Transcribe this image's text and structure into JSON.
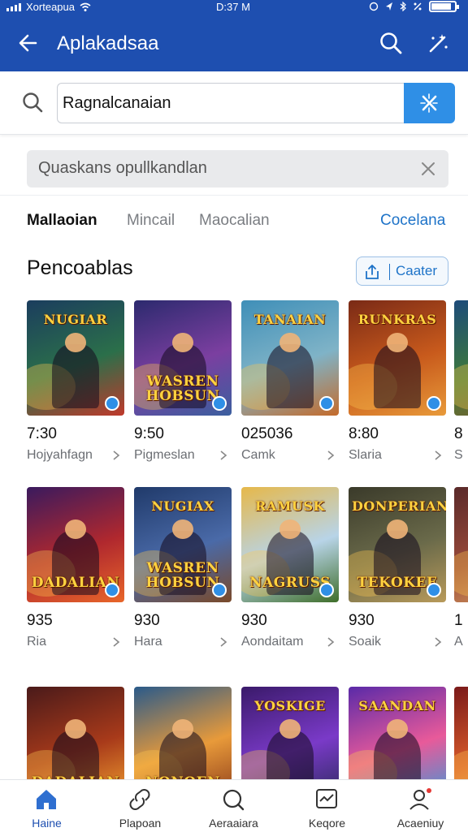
{
  "status_bar": {
    "carrier": "Xorteapua",
    "time": "D:37 M"
  },
  "app_bar": {
    "title": "Aplakadsaa"
  },
  "search": {
    "value": "Ragnalcanaian"
  },
  "query_chip": {
    "text": "Quaskans opullkandlan"
  },
  "tabs": [
    {
      "label": "Mallaoian"
    },
    {
      "label": "Mincail"
    },
    {
      "label": "Maocalian"
    },
    {
      "label": "Cocelana"
    }
  ],
  "section": {
    "title": "Pencoablas",
    "filter_label": "Caater"
  },
  "cards": [
    {
      "art_top": "NUGIAR",
      "art_bottom": "",
      "price": "7:30",
      "sub": "Hojyahfagn",
      "palette": [
        "#1b3d5e",
        "#2b6f4a",
        "#c0392b"
      ]
    },
    {
      "art_top": "",
      "art_bottom": "WASREN HOBSUN",
      "price": "9:50",
      "sub": "Pigmeslan",
      "palette": [
        "#2c2a6e",
        "#7b3fa0",
        "#3b5f9f"
      ]
    },
    {
      "art_top": "TANAIAN",
      "art_bottom": "",
      "price": "025036",
      "sub": "Camk",
      "palette": [
        "#3f8fb8",
        "#7fb3c7",
        "#c46b2b"
      ]
    },
    {
      "art_top": "RUNKRAS",
      "art_bottom": "",
      "price": "8:80",
      "sub": "Slaria",
      "palette": [
        "#7a2a16",
        "#c85a1c",
        "#e89a3a"
      ]
    },
    {
      "art_top": "",
      "art_bottom": "",
      "price": "8",
      "sub": "S",
      "palette": [
        "#1d4b7a",
        "#3e7a3a",
        "#8a5a2a"
      ]
    },
    {
      "art_top": "",
      "art_bottom": "DADALIAN",
      "price": "935",
      "sub": "Ria",
      "palette": [
        "#3a1a5e",
        "#b0282e",
        "#e8662a"
      ]
    },
    {
      "art_top": "NUGIAX",
      "art_bottom": "WASREN HOBSUN",
      "price": "930",
      "sub": "Hara",
      "palette": [
        "#203a6a",
        "#4a6aa8",
        "#7a4a2a"
      ]
    },
    {
      "art_top": "RAMUSK",
      "art_bottom": "NAGRUSS",
      "price": "930",
      "sub": "Aondaitam",
      "palette": [
        "#e6b84a",
        "#b8d4e8",
        "#3f6e2a"
      ]
    },
    {
      "art_top": "DONPERIAN",
      "art_bottom": "TEKOKEE",
      "price": "930",
      "sub": "Soaik",
      "palette": [
        "#3a3a2a",
        "#6a6a4a",
        "#b89a5a"
      ]
    },
    {
      "art_top": "",
      "art_bottom": "",
      "price": "1",
      "sub": "A",
      "palette": [
        "#5a2a2a",
        "#9a4a3a",
        "#d8a060"
      ]
    },
    {
      "art_top": "",
      "art_bottom": "DADALIAN",
      "price": "",
      "sub": "",
      "palette": [
        "#4a1a1a",
        "#a83a1a",
        "#f0a030"
      ]
    },
    {
      "art_top": "",
      "art_bottom": "NONOEN",
      "price": "",
      "sub": "",
      "palette": [
        "#2a5a8a",
        "#e89a3a",
        "#8a3a1a"
      ]
    },
    {
      "art_top": "YOSKIGE",
      "art_bottom": "",
      "price": "",
      "sub": "",
      "palette": [
        "#3a1a6a",
        "#7a3ac8",
        "#2a2a5a"
      ]
    },
    {
      "art_top": "SAANDAN",
      "art_bottom": "",
      "price": "",
      "sub": "",
      "palette": [
        "#5a2aa8",
        "#e85a9a",
        "#3a9ad8"
      ]
    },
    {
      "art_top": "",
      "art_bottom": "",
      "price": "",
      "sub": "",
      "palette": [
        "#7a1a1a",
        "#d85a2a",
        "#f0c050"
      ]
    }
  ],
  "bottom_nav": [
    {
      "label": "Haine",
      "icon": "home-icon"
    },
    {
      "label": "Plapoan",
      "icon": "link-icon"
    },
    {
      "label": "Aeraaiara",
      "icon": "search-icon"
    },
    {
      "label": "Keqore",
      "icon": "chart-icon"
    },
    {
      "label": "Acaeniuy",
      "icon": "account-icon"
    }
  ],
  "colors": {
    "primary": "#1e4fb0",
    "accent": "#2f8fe6",
    "link": "#1e73c8"
  }
}
